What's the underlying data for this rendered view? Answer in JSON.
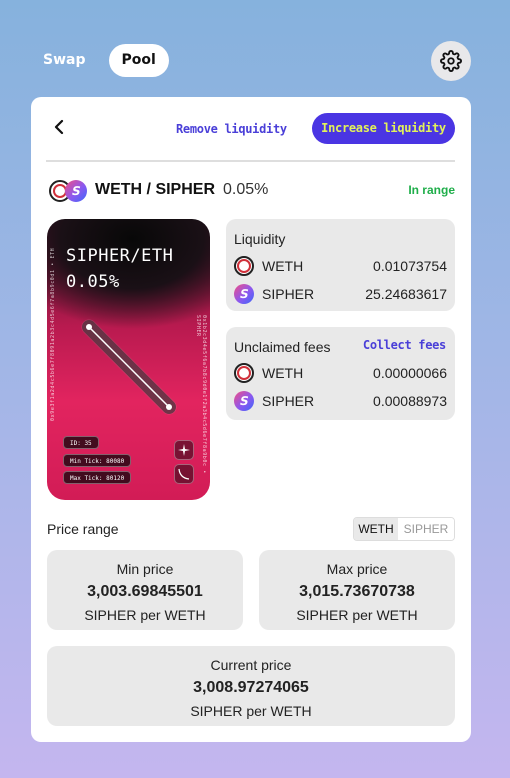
{
  "nav": {
    "tabs": [
      {
        "label": "Swap",
        "active": false
      },
      {
        "label": "Pool",
        "active": true
      }
    ]
  },
  "header": {
    "remove_label": "Remove liquidity",
    "increase_label": "Increase liquidity"
  },
  "position": {
    "pair": "WETH / SIPHER",
    "fee": "0.05%",
    "status": "In range"
  },
  "nft": {
    "title_line1": "SIPHER/ETH",
    "title_line2": "0.05%",
    "id_label": "ID: 35",
    "min_tick_label": "Min Tick: 80080",
    "max_tick_label": "Max Tick: 80120",
    "side_text_left": "0x9e3f1a2d4c5b6e7f8091a2b3c4d5e6f7a8b9c0d1 • ETH",
    "side_text_right": "0x1b2c3d4e5f6a7b8c9d0e1f2a3b4c5d6e7f8a9b0c • SIPHER"
  },
  "liquidity": {
    "title": "Liquidity",
    "rows": [
      {
        "token": "WETH",
        "value": "0.01073754"
      },
      {
        "token": "SIPHER",
        "value": "25.24683617"
      }
    ]
  },
  "fees": {
    "title": "Unclaimed fees",
    "collect_label": "Collect fees",
    "rows": [
      {
        "token": "WETH",
        "value": "0.00000066"
      },
      {
        "token": "SIPHER",
        "value": "0.00088973"
      }
    ]
  },
  "price_range": {
    "label": "Price range",
    "toggle": {
      "active": "WETH",
      "inactive": "SIPHER"
    },
    "min": {
      "label": "Min price",
      "value": "3,003.69845501",
      "unit": "SIPHER per WETH"
    },
    "max": {
      "label": "Max price",
      "value": "3,015.73670738",
      "unit": "SIPHER per WETH"
    },
    "current": {
      "label": "Current price",
      "value": "3,008.97274065",
      "unit": "SIPHER per WETH"
    }
  },
  "colors": {
    "accent": "#4a35e3",
    "accent_text": "#e2f25a",
    "in_range": "#1fae4a",
    "nft_pink": "#e2245f"
  },
  "icons": [
    "gear-icon",
    "back-arrow-icon",
    "weth-token-icon",
    "sipher-token-icon",
    "sparkle-icon",
    "curve-icon"
  ]
}
